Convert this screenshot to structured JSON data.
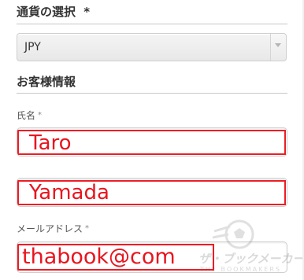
{
  "currency": {
    "heading": "通貨の選択",
    "required_mark": "*",
    "selected_value": "JPY",
    "arrow_icon": "triangle-down-icon"
  },
  "customer": {
    "heading": "お客様情報",
    "name_label": "氏名",
    "name_required_mark": "*",
    "first_name_value": "Taro",
    "last_name_value": "Yamada",
    "email_label": "メールアドレス",
    "email_required_mark": "*",
    "email_value": "thabook@com"
  },
  "watermark": {
    "text": "ザ・ブックメーカーズ",
    "subtext": "THE BOOKMAKERS"
  },
  "colors": {
    "annotation_red": "#ee1c24",
    "border": "#cfcfcf",
    "text": "#333333"
  }
}
